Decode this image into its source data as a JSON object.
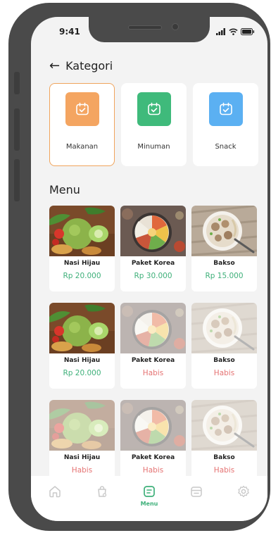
{
  "status": {
    "time": "9:41"
  },
  "header": {
    "title": "Kategori"
  },
  "categories": [
    {
      "label": "Makanan",
      "color": "#f4a561",
      "active": true
    },
    {
      "label": "Minuman",
      "color": "#3fba7b",
      "active": false
    },
    {
      "label": "Snack",
      "color": "#5bb0f2",
      "active": false
    }
  ],
  "menu": {
    "title": "Menu",
    "items": [
      {
        "name": "Nasi Hijau",
        "price": "Rp 20.000",
        "available": true,
        "dish": "nasi"
      },
      {
        "name": "Paket Korea",
        "price": "Rp 30.000",
        "available": true,
        "dish": "korea"
      },
      {
        "name": "Bakso",
        "price": "Rp 15.000",
        "available": true,
        "dish": "bakso"
      },
      {
        "name": "Nasi Hijau",
        "price": "Rp 20.000",
        "available": true,
        "dish": "nasi"
      },
      {
        "name": "Paket Korea",
        "price": "Habis",
        "available": false,
        "dish": "korea"
      },
      {
        "name": "Bakso",
        "price": "Habis",
        "available": false,
        "dish": "bakso"
      },
      {
        "name": "Nasi Hijau",
        "price": "Habis",
        "available": false,
        "dish": "nasi"
      },
      {
        "name": "Paket Korea",
        "price": "Habis",
        "available": false,
        "dish": "korea"
      },
      {
        "name": "Bakso",
        "price": "Habis",
        "available": false,
        "dish": "bakso"
      }
    ]
  },
  "nav": {
    "active_label": "Menu",
    "items": [
      "home-icon",
      "bag-icon",
      "menu-icon",
      "calendar-icon",
      "settings-icon"
    ]
  },
  "colors": {
    "accent": "#3fb07a",
    "soldout": "#e57373",
    "active_border": "#f0a45c"
  }
}
